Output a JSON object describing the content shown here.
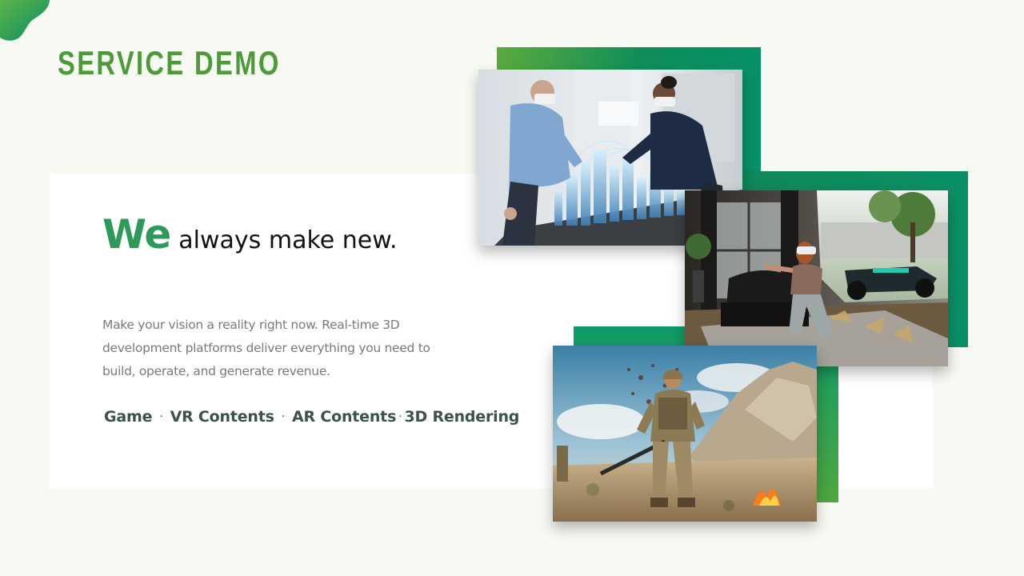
{
  "slide": {
    "title": "SERVICE DEMO",
    "headline_accent": "We",
    "headline_rest": "always make new.",
    "description": "Make your vision a reality right now. Real-time 3D development platforms deliver everything you need to build, operate, and generate revenue.",
    "services": [
      "Game",
      "VR Contents",
      "AR Contents",
      "3D Rendering"
    ],
    "separator": "·"
  },
  "colors": {
    "accent": "#4e9a3a",
    "headline_accent": "#2e9a5a",
    "frame_green": "#0f8e5a",
    "background": "#f7faf2",
    "card": "#ffffff"
  }
}
